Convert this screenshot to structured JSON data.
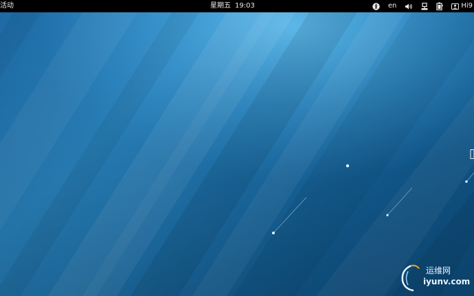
{
  "topbar": {
    "activities_label": "活动",
    "clock": {
      "day": "星期五",
      "time": "19:03"
    },
    "keyboard_lang": "en",
    "user_label": "Hi9",
    "icons": [
      "accessibility-icon",
      "volume-icon",
      "network-icon",
      "battery-icon",
      "user-icon"
    ]
  },
  "watermark": {
    "cn": "运维网",
    "en": "iyunv.com"
  },
  "colors": {
    "topbar_bg": "#000000",
    "topbar_text": "#eeeeec",
    "wallpaper_light": "#3b9ad6",
    "wallpaper_dark": "#0b4e7c"
  }
}
